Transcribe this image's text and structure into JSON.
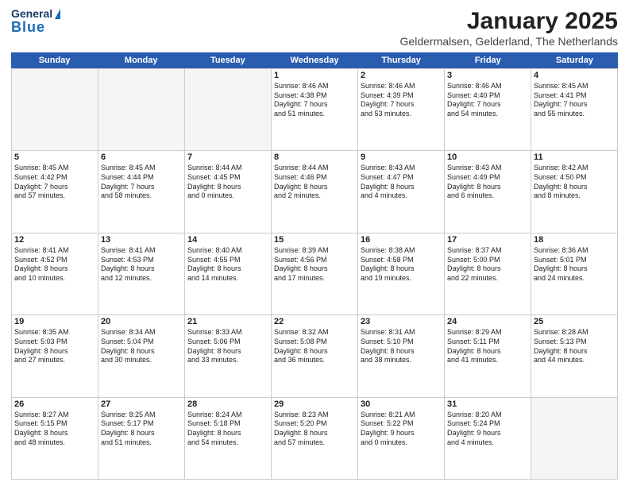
{
  "header": {
    "logo_general": "General",
    "logo_blue": "Blue",
    "month_title": "January 2025",
    "location": "Geldermalsen, Gelderland, The Netherlands"
  },
  "days_of_week": [
    "Sunday",
    "Monday",
    "Tuesday",
    "Wednesday",
    "Thursday",
    "Friday",
    "Saturday"
  ],
  "weeks": [
    [
      {
        "day": "",
        "lines": [],
        "empty": true
      },
      {
        "day": "",
        "lines": [],
        "empty": true
      },
      {
        "day": "",
        "lines": [],
        "empty": true
      },
      {
        "day": "1",
        "lines": [
          "Sunrise: 8:46 AM",
          "Sunset: 4:38 PM",
          "Daylight: 7 hours",
          "and 51 minutes."
        ],
        "empty": false
      },
      {
        "day": "2",
        "lines": [
          "Sunrise: 8:46 AM",
          "Sunset: 4:39 PM",
          "Daylight: 7 hours",
          "and 53 minutes."
        ],
        "empty": false
      },
      {
        "day": "3",
        "lines": [
          "Sunrise: 8:46 AM",
          "Sunset: 4:40 PM",
          "Daylight: 7 hours",
          "and 54 minutes."
        ],
        "empty": false
      },
      {
        "day": "4",
        "lines": [
          "Sunrise: 8:45 AM",
          "Sunset: 4:41 PM",
          "Daylight: 7 hours",
          "and 55 minutes."
        ],
        "empty": false
      }
    ],
    [
      {
        "day": "5",
        "lines": [
          "Sunrise: 8:45 AM",
          "Sunset: 4:42 PM",
          "Daylight: 7 hours",
          "and 57 minutes."
        ],
        "empty": false
      },
      {
        "day": "6",
        "lines": [
          "Sunrise: 8:45 AM",
          "Sunset: 4:44 PM",
          "Daylight: 7 hours",
          "and 58 minutes."
        ],
        "empty": false
      },
      {
        "day": "7",
        "lines": [
          "Sunrise: 8:44 AM",
          "Sunset: 4:45 PM",
          "Daylight: 8 hours",
          "and 0 minutes."
        ],
        "empty": false
      },
      {
        "day": "8",
        "lines": [
          "Sunrise: 8:44 AM",
          "Sunset: 4:46 PM",
          "Daylight: 8 hours",
          "and 2 minutes."
        ],
        "empty": false
      },
      {
        "day": "9",
        "lines": [
          "Sunrise: 8:43 AM",
          "Sunset: 4:47 PM",
          "Daylight: 8 hours",
          "and 4 minutes."
        ],
        "empty": false
      },
      {
        "day": "10",
        "lines": [
          "Sunrise: 8:43 AM",
          "Sunset: 4:49 PM",
          "Daylight: 8 hours",
          "and 6 minutes."
        ],
        "empty": false
      },
      {
        "day": "11",
        "lines": [
          "Sunrise: 8:42 AM",
          "Sunset: 4:50 PM",
          "Daylight: 8 hours",
          "and 8 minutes."
        ],
        "empty": false
      }
    ],
    [
      {
        "day": "12",
        "lines": [
          "Sunrise: 8:41 AM",
          "Sunset: 4:52 PM",
          "Daylight: 8 hours",
          "and 10 minutes."
        ],
        "empty": false
      },
      {
        "day": "13",
        "lines": [
          "Sunrise: 8:41 AM",
          "Sunset: 4:53 PM",
          "Daylight: 8 hours",
          "and 12 minutes."
        ],
        "empty": false
      },
      {
        "day": "14",
        "lines": [
          "Sunrise: 8:40 AM",
          "Sunset: 4:55 PM",
          "Daylight: 8 hours",
          "and 14 minutes."
        ],
        "empty": false
      },
      {
        "day": "15",
        "lines": [
          "Sunrise: 8:39 AM",
          "Sunset: 4:56 PM",
          "Daylight: 8 hours",
          "and 17 minutes."
        ],
        "empty": false
      },
      {
        "day": "16",
        "lines": [
          "Sunrise: 8:38 AM",
          "Sunset: 4:58 PM",
          "Daylight: 8 hours",
          "and 19 minutes."
        ],
        "empty": false
      },
      {
        "day": "17",
        "lines": [
          "Sunrise: 8:37 AM",
          "Sunset: 5:00 PM",
          "Daylight: 8 hours",
          "and 22 minutes."
        ],
        "empty": false
      },
      {
        "day": "18",
        "lines": [
          "Sunrise: 8:36 AM",
          "Sunset: 5:01 PM",
          "Daylight: 8 hours",
          "and 24 minutes."
        ],
        "empty": false
      }
    ],
    [
      {
        "day": "19",
        "lines": [
          "Sunrise: 8:35 AM",
          "Sunset: 5:03 PM",
          "Daylight: 8 hours",
          "and 27 minutes."
        ],
        "empty": false
      },
      {
        "day": "20",
        "lines": [
          "Sunrise: 8:34 AM",
          "Sunset: 5:04 PM",
          "Daylight: 8 hours",
          "and 30 minutes."
        ],
        "empty": false
      },
      {
        "day": "21",
        "lines": [
          "Sunrise: 8:33 AM",
          "Sunset: 5:06 PM",
          "Daylight: 8 hours",
          "and 33 minutes."
        ],
        "empty": false
      },
      {
        "day": "22",
        "lines": [
          "Sunrise: 8:32 AM",
          "Sunset: 5:08 PM",
          "Daylight: 8 hours",
          "and 36 minutes."
        ],
        "empty": false
      },
      {
        "day": "23",
        "lines": [
          "Sunrise: 8:31 AM",
          "Sunset: 5:10 PM",
          "Daylight: 8 hours",
          "and 38 minutes."
        ],
        "empty": false
      },
      {
        "day": "24",
        "lines": [
          "Sunrise: 8:29 AM",
          "Sunset: 5:11 PM",
          "Daylight: 8 hours",
          "and 41 minutes."
        ],
        "empty": false
      },
      {
        "day": "25",
        "lines": [
          "Sunrise: 8:28 AM",
          "Sunset: 5:13 PM",
          "Daylight: 8 hours",
          "and 44 minutes."
        ],
        "empty": false
      }
    ],
    [
      {
        "day": "26",
        "lines": [
          "Sunrise: 8:27 AM",
          "Sunset: 5:15 PM",
          "Daylight: 8 hours",
          "and 48 minutes."
        ],
        "empty": false
      },
      {
        "day": "27",
        "lines": [
          "Sunrise: 8:25 AM",
          "Sunset: 5:17 PM",
          "Daylight: 8 hours",
          "and 51 minutes."
        ],
        "empty": false
      },
      {
        "day": "28",
        "lines": [
          "Sunrise: 8:24 AM",
          "Sunset: 5:18 PM",
          "Daylight: 8 hours",
          "and 54 minutes."
        ],
        "empty": false
      },
      {
        "day": "29",
        "lines": [
          "Sunrise: 8:23 AM",
          "Sunset: 5:20 PM",
          "Daylight: 8 hours",
          "and 57 minutes."
        ],
        "empty": false
      },
      {
        "day": "30",
        "lines": [
          "Sunrise: 8:21 AM",
          "Sunset: 5:22 PM",
          "Daylight: 9 hours",
          "and 0 minutes."
        ],
        "empty": false
      },
      {
        "day": "31",
        "lines": [
          "Sunrise: 8:20 AM",
          "Sunset: 5:24 PM",
          "Daylight: 9 hours",
          "and 4 minutes."
        ],
        "empty": false
      },
      {
        "day": "",
        "lines": [],
        "empty": true
      }
    ]
  ]
}
